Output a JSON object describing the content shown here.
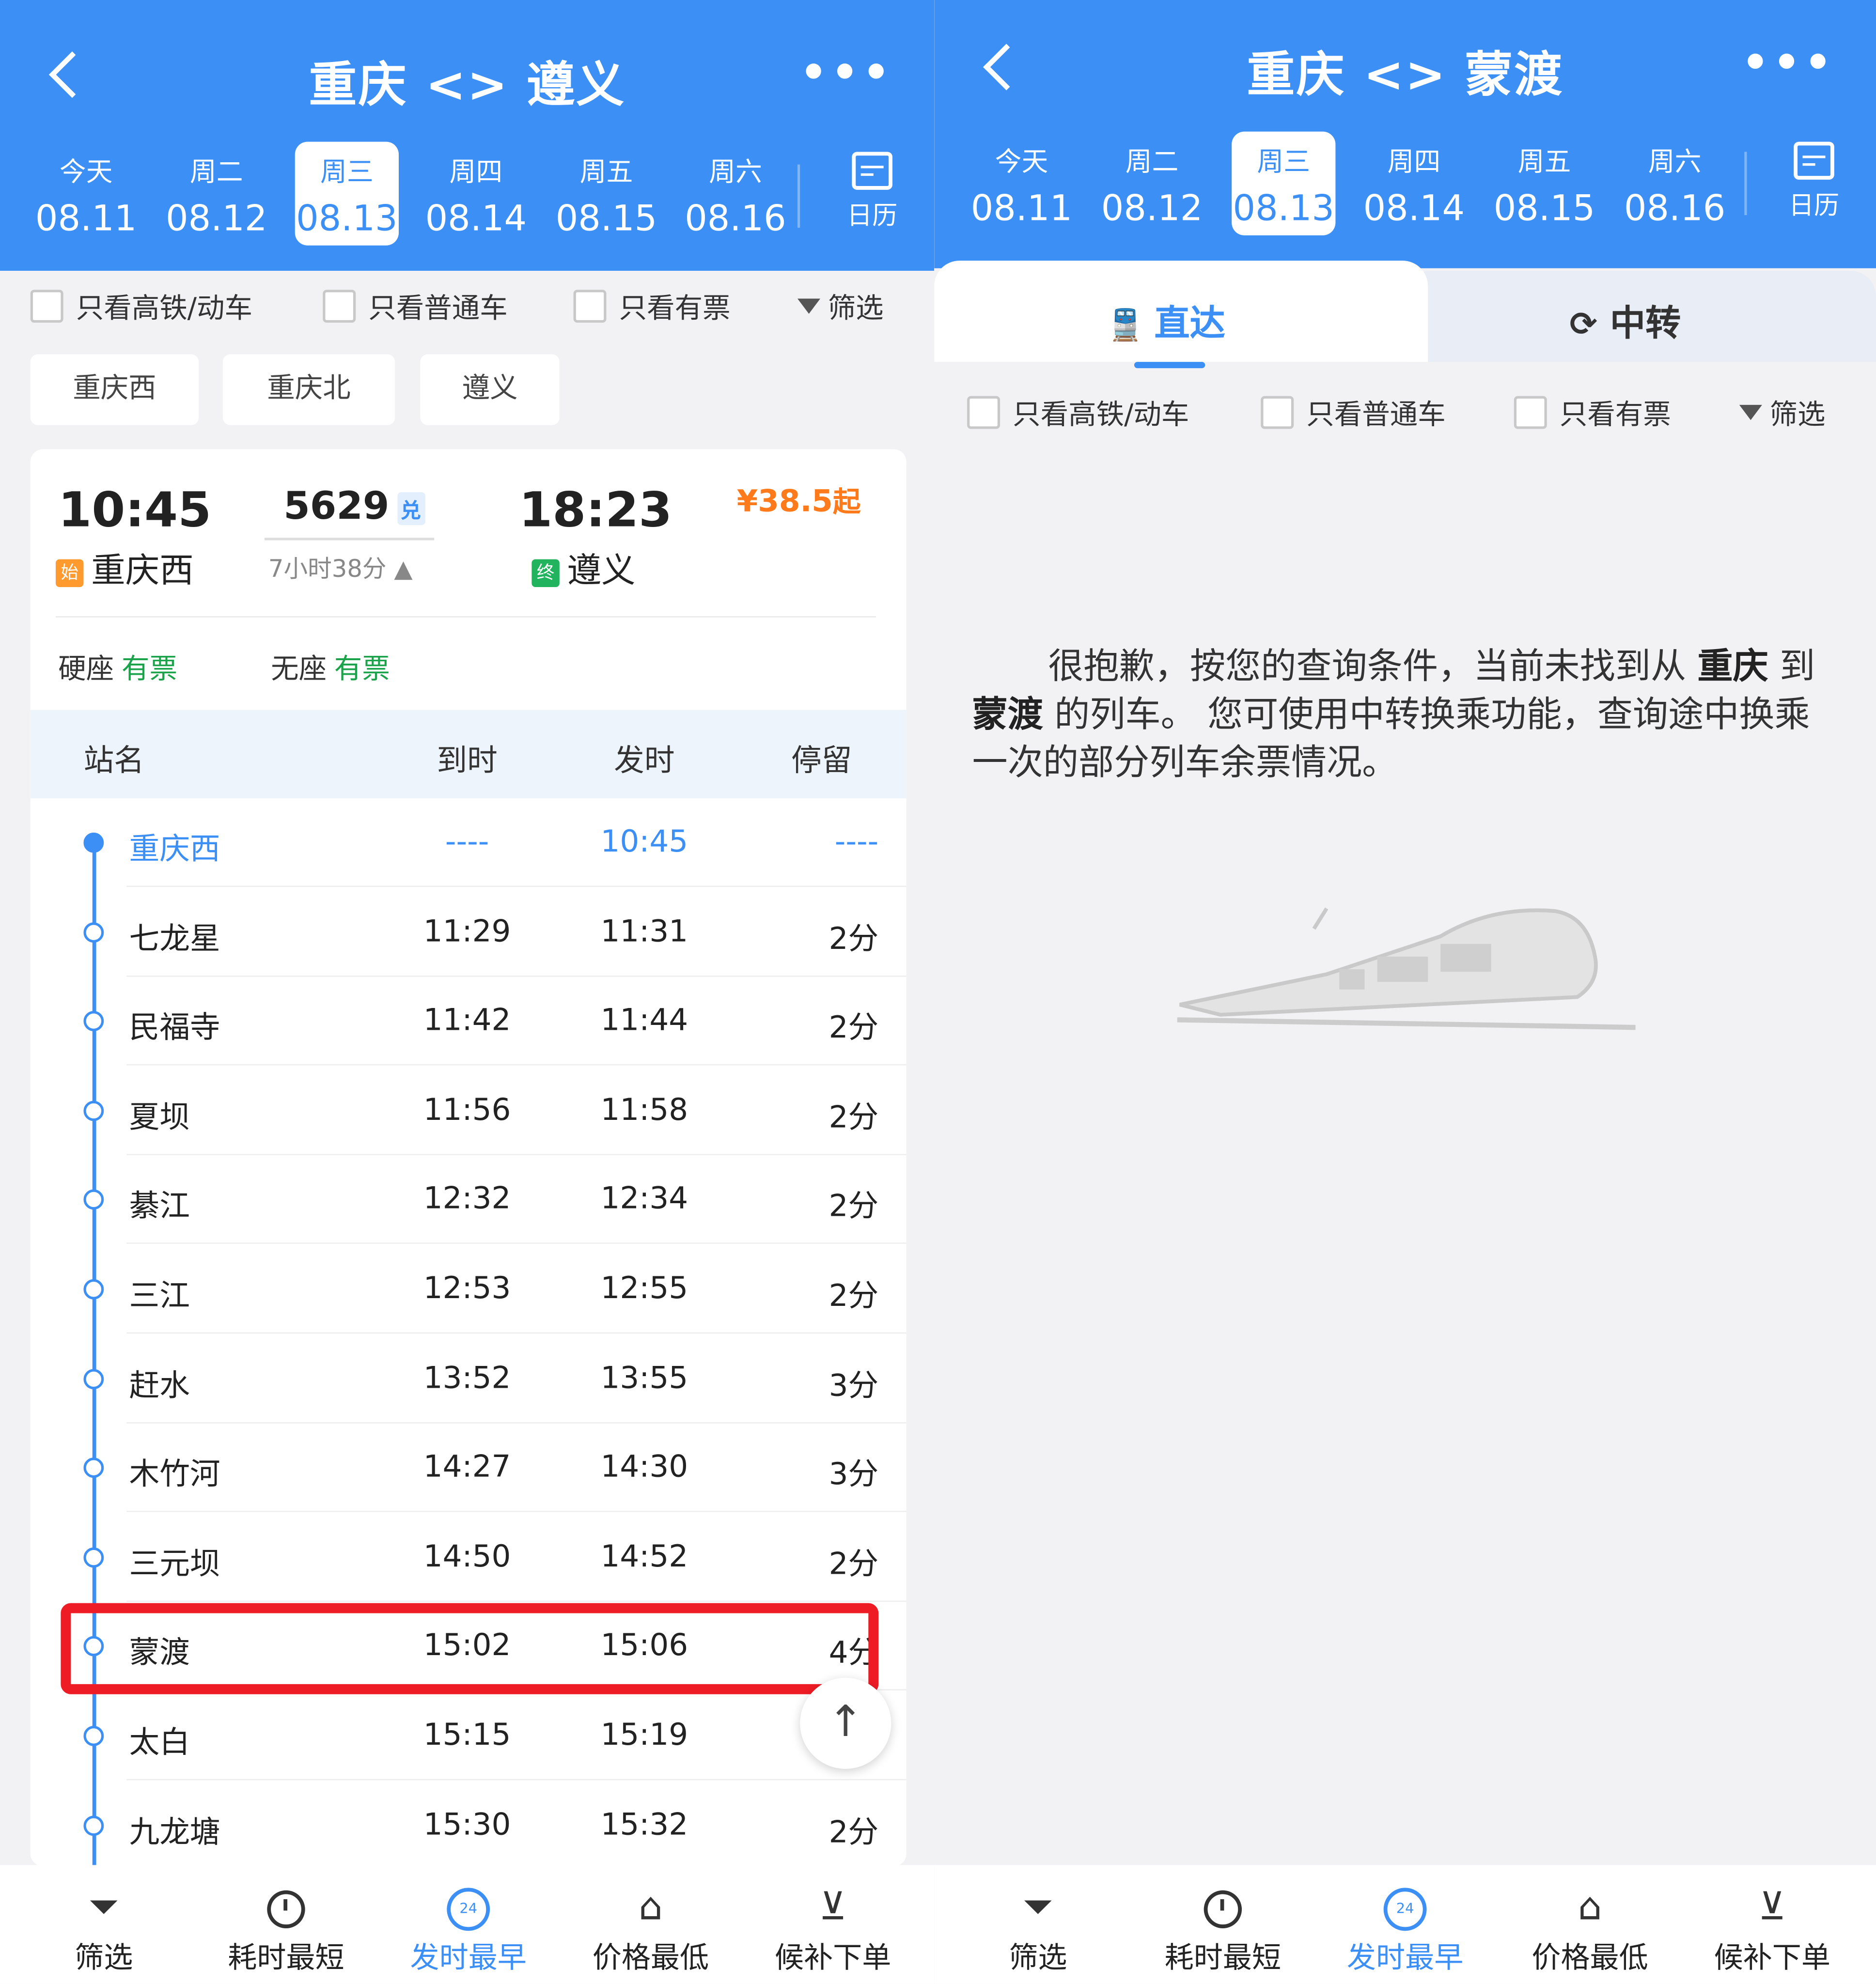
{
  "left": {
    "title": "重庆 <> 遵义",
    "more": "•••",
    "dates": [
      {
        "w": "今天",
        "d": "08.11"
      },
      {
        "w": "周二",
        "d": "08.12"
      },
      {
        "w": "周三",
        "d": "08.13"
      },
      {
        "w": "周四",
        "d": "08.14"
      },
      {
        "w": "周五",
        "d": "08.15"
      },
      {
        "w": "周六",
        "d": "08.16"
      }
    ],
    "calendar_label": "日历",
    "filters": {
      "highspeed": "只看高铁/动车",
      "normal": "只看普通车",
      "available": "只看有票",
      "filter": "筛选"
    },
    "station_buttons": [
      "重庆西",
      "重庆北",
      "遵义"
    ],
    "train": {
      "dep_time": "10:45",
      "dep_tag": "始",
      "dep_station": "重庆西",
      "number": "5629",
      "badge": "兑",
      "duration": "7小时38分 ▲",
      "arr_time": "18:23",
      "arr_tag": "终",
      "arr_station": "遵义",
      "price": "¥38.5",
      "price_suffix": "起",
      "seat1_label": "硬座",
      "seat1_status": "有票",
      "seat2_label": "无座",
      "seat2_status": "有票"
    },
    "table_headers": {
      "name": "站名",
      "arr": "到时",
      "dep": "发时",
      "stop": "停留"
    },
    "stops": [
      {
        "name": "重庆西",
        "arr": "----",
        "dep": "10:45",
        "stop": "----"
      },
      {
        "name": "七龙星",
        "arr": "11:29",
        "dep": "11:31",
        "stop": "2分"
      },
      {
        "name": "民福寺",
        "arr": "11:42",
        "dep": "11:44",
        "stop": "2分"
      },
      {
        "name": "夏坝",
        "arr": "11:56",
        "dep": "11:58",
        "stop": "2分"
      },
      {
        "name": "綦江",
        "arr": "12:32",
        "dep": "12:34",
        "stop": "2分"
      },
      {
        "name": "三江",
        "arr": "12:53",
        "dep": "12:55",
        "stop": "2分"
      },
      {
        "name": "赶水",
        "arr": "13:52",
        "dep": "13:55",
        "stop": "3分"
      },
      {
        "name": "木竹河",
        "arr": "14:27",
        "dep": "14:30",
        "stop": "3分"
      },
      {
        "name": "三元坝",
        "arr": "14:50",
        "dep": "14:52",
        "stop": "2分"
      },
      {
        "name": "蒙渡",
        "arr": "15:02",
        "dep": "15:06",
        "stop": "4分"
      },
      {
        "name": "太白",
        "arr": "15:15",
        "dep": "15:19",
        "stop": ""
      },
      {
        "name": "九龙塘",
        "arr": "15:30",
        "dep": "15:32",
        "stop": "2分"
      }
    ],
    "bottom": [
      "筛选",
      "耗时最短",
      "发时最早",
      "价格最低",
      "候补下单"
    ]
  },
  "right": {
    "title": "重庆 <> 蒙渡",
    "more": "•••",
    "dates": [
      {
        "w": "今天",
        "d": "08.11"
      },
      {
        "w": "周二",
        "d": "08.12"
      },
      {
        "w": "周三",
        "d": "08.13"
      },
      {
        "w": "周四",
        "d": "08.14"
      },
      {
        "w": "周五",
        "d": "08.15"
      },
      {
        "w": "周六",
        "d": "08.16"
      }
    ],
    "calendar_label": "日历",
    "tabs": {
      "direct": "直达",
      "transfer": "中转"
    },
    "filters": {
      "highspeed": "只看高铁/动车",
      "normal": "只看普通车",
      "available": "只看有票",
      "filter": "筛选"
    },
    "message": {
      "p1": "很抱歉，按您的查询条件，当前未找到从 ",
      "from": "重庆",
      "p2": " 到 ",
      "to": "蒙渡",
      "p3": " 的列车。 您可使用中转换乘功能，查询途中换乘一次的部分列车余票情况。"
    },
    "bottom": [
      "筛选",
      "耗时最短",
      "发时最早",
      "价格最低",
      "候补下单"
    ]
  },
  "colors": {
    "accent": "#3b8ff5",
    "price": "#ff7a1a",
    "available": "#1aa34a",
    "highlight": "#ee1c25"
  }
}
